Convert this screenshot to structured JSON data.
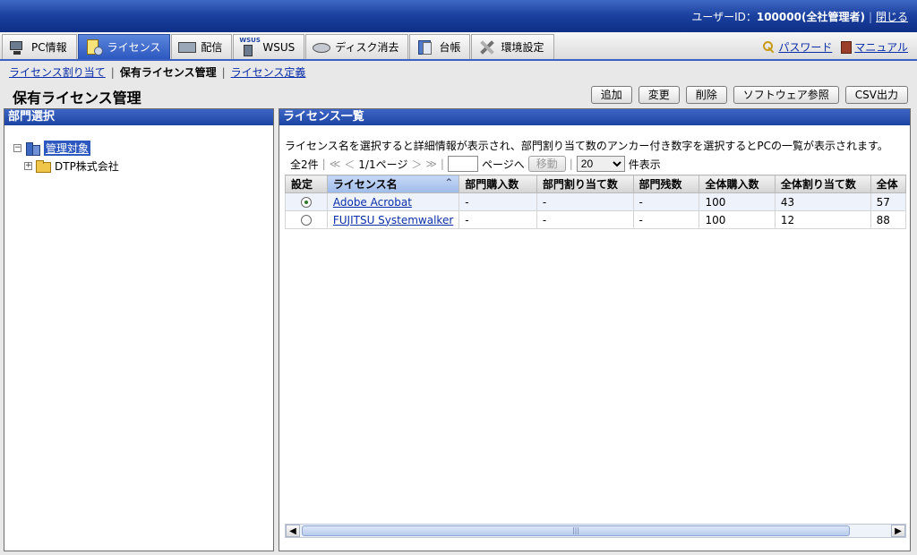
{
  "header": {
    "user_label": "ユーザーID：",
    "user_value": "100000(全社管理者)",
    "close_label": "閉じる"
  },
  "tabs": [
    {
      "label": "PC情報",
      "icon": "pc-icon"
    },
    {
      "label": "ライセンス",
      "icon": "license-icon",
      "active": true
    },
    {
      "label": "配信",
      "icon": "distribution-icon"
    },
    {
      "label": "WSUS",
      "icon": "wsus-icon",
      "icon_text": "WSUS"
    },
    {
      "label": "ディスク消去",
      "icon": "disk-icon"
    },
    {
      "label": "台帳",
      "icon": "ledger-icon"
    },
    {
      "label": "環境設定",
      "icon": "settings-icon"
    }
  ],
  "tools": {
    "password": "パスワード",
    "manual": "マニュアル"
  },
  "subnav": {
    "items": [
      "ライセンス割り当て",
      "保有ライセンス管理",
      "ライセンス定義"
    ],
    "current": 1
  },
  "page": {
    "title": "保有ライセンス管理"
  },
  "actions": [
    "追加",
    "変更",
    "削除",
    "ソフトウェア参照",
    "CSV出力"
  ],
  "left_panel": {
    "title": "部門選択",
    "tree_root": "管理対象",
    "tree_child": "DTP株式会社",
    "expander_root": "−",
    "expander_child": "+"
  },
  "right_panel": {
    "title": "ライセンス一覧",
    "description": "ライセンス名を選択すると詳細情報が表示され、部門割り当て数のアンカー付き数字を選択するとPCの一覧が表示されます。",
    "pager": {
      "total": "全2件",
      "first": "≪",
      "prev": "＜",
      "page_info": "1/1ページ",
      "next": "＞",
      "last": "≫",
      "goto_suffix": "ページへ",
      "move_button": "移動",
      "per_page_value": "20",
      "per_page_suffix": "件表示"
    },
    "table": {
      "columns": [
        "設定",
        "ライセンス名",
        "部門購入数",
        "部門割り当て数",
        "部門残数",
        "全体購入数",
        "全体割り当て数",
        "全体"
      ],
      "rows": [
        {
          "selected": true,
          "name": "Adobe Acrobat",
          "dept_purchase": "-",
          "dept_assigned": "-",
          "dept_remaining": "-",
          "total_purchase": "100",
          "total_assigned": "43",
          "total_remaining": "57"
        },
        {
          "selected": false,
          "name": "FUJITSU Systemwalker",
          "dept_purchase": "-",
          "dept_assigned": "-",
          "dept_remaining": "-",
          "total_purchase": "100",
          "total_assigned": "12",
          "total_remaining": "88"
        }
      ]
    },
    "scrollbar": {
      "left_arrow": "◀",
      "right_arrow": "▶",
      "grip": "|||"
    }
  },
  "colors": {
    "header_blue": "#1a3f9e",
    "link": "#0a2ea8",
    "active_tab": "#2d58bf"
  }
}
